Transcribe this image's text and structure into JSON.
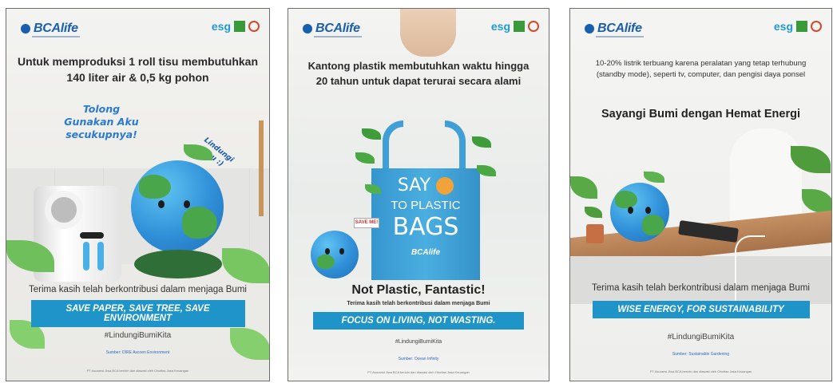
{
  "posters": [
    {
      "logo_text": "BCAlife",
      "esg_label": "esg",
      "headline": "Untuk memproduksi 1 roll tisu membutuhkan 140 liter air & 0,5 kg pohon",
      "bubble_left": "Tolong Gunakan Aku secukupnya!",
      "bubble_right": "Lindungi Aku :)",
      "thanks": "Terima kasih telah berkontribusi dalam menjaga Bumi",
      "banner": "SAVE PAPER, SAVE TREE, SAVE ENVIRONMENT",
      "hashtag": "#LindungiBumiKita",
      "source": "Sumber: DIRE Ascoen Environment",
      "footer": "PT Asuransi Jiwa BCA berizin dan diawasi oleh Otoritas Jasa Keuangan"
    },
    {
      "logo_text": "BCAlife",
      "esg_label": "esg",
      "headline": "Kantong plastik membutuhkan waktu hingga 20 tahun untuk dapat terurai secara alami",
      "bag_line1": "SAY",
      "bag_line2": "TO PLASTIC",
      "bag_line3": "BAGS",
      "bag_brand": "BCAlife",
      "sign": "SAVE ME!",
      "title": "Not Plastic, Fantastic!",
      "thanks": "Terima kasih telah berkontribusi dalam menjaga Bumi",
      "banner": "FOCUS ON LIVING, NOT WASTING.",
      "hashtag": "#LindungiBumiKita",
      "source": "Sumber: Ocean Infinity",
      "footer": "PT Asuransi Jiwa BCA berizin dan diawasi oleh Otoritas Jasa Keuangan"
    },
    {
      "logo_text": "BCAlife",
      "esg_label": "esg",
      "headline": "10-20% listrik terbuang karena peralatan yang tetap terhubung (standby mode), seperti tv, computer, dan pengisi daya ponsel",
      "title": "Sayangi Bumi dengan Hemat Energi",
      "thanks": "Terima kasih telah berkontribusi dalam menjaga Bumi",
      "banner": "WISE ENERGY, FOR SUSTAINABILITY",
      "hashtag": "#LindungiBumiKita",
      "source": "Sumber: Sustainable Gardening",
      "footer": "PT Asuransi Jiwa BCA berizin dan diawasi oleh Otoritas Jasa Keuangan"
    }
  ]
}
